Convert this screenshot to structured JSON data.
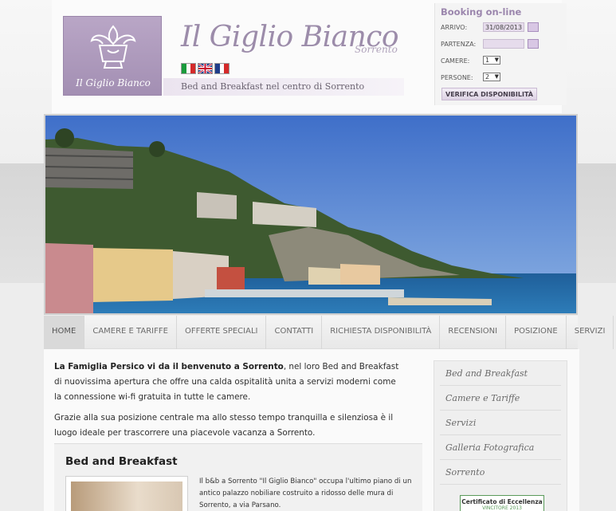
{
  "header": {
    "logo_text": "Il Giglio Bianco",
    "site_title": "Il Giglio Bianco",
    "site_subtitle": "Sorrento",
    "tagline": "Bed and Breakfast nel centro di Sorrento",
    "flags": [
      "flag-italy-icon",
      "flag-uk-icon",
      "flag-france-icon"
    ]
  },
  "booking": {
    "title": "Booking on-line",
    "arrivo_label": "ARRIVO:",
    "arrivo_value": "31/08/2013",
    "partenza_label": "PARTENZA:",
    "partenza_value": "",
    "camere_label": "CAMERE:",
    "camere_value": "1",
    "persone_label": "PERSONE:",
    "persone_value": "2",
    "submit_label": "VERIFICA DISPONIBILITÀ"
  },
  "nav": {
    "items": [
      {
        "label": "HOME"
      },
      {
        "label": "CAMERE E TARIFFE"
      },
      {
        "label": "OFFERTE SPECIALI"
      },
      {
        "label": "CONTATTI"
      },
      {
        "label": "RICHIESTA DISPONIBILITÀ"
      },
      {
        "label": "RECENSIONI"
      },
      {
        "label": "POSIZIONE"
      },
      {
        "label": "SERVIZI"
      }
    ]
  },
  "main": {
    "intro_bold": "La Famiglia Persico vi da il benvenuto a Sorrento",
    "intro_rest": ", nel loro Bed and Breakfast di nuovissima apertura che offre una calda ospitalità unita a servizi moderni come la connessione wi-fi gratuita in tutte le camere.",
    "intro_p2": "Grazie alla sua posizione centrale ma allo stesso tempo tranquilla e silenziosa è il luogo ideale per trascorrere una piacevole vacanza a Sorrento.",
    "bb_title": "Bed and Breakfast",
    "bb_text": "Il b&b a Sorrento \"Il Giglio Bianco\" occupa l'ultimo piano di un antico palazzo nobiliare costruito a ridosso delle mura di Sorrento, a via Parsano."
  },
  "sidebar": {
    "items": [
      {
        "label": "Bed and Breakfast"
      },
      {
        "label": "Camere e Tariffe"
      },
      {
        "label": "Servizi"
      },
      {
        "label": "Galleria Fotografica"
      },
      {
        "label": "Sorrento"
      }
    ],
    "cert_title": "Certificato di Eccellenza",
    "cert_sub": "VINCITORE 2013"
  },
  "colors": {
    "accent": "#9b86ad",
    "logo_bg": "#a38fb3"
  }
}
